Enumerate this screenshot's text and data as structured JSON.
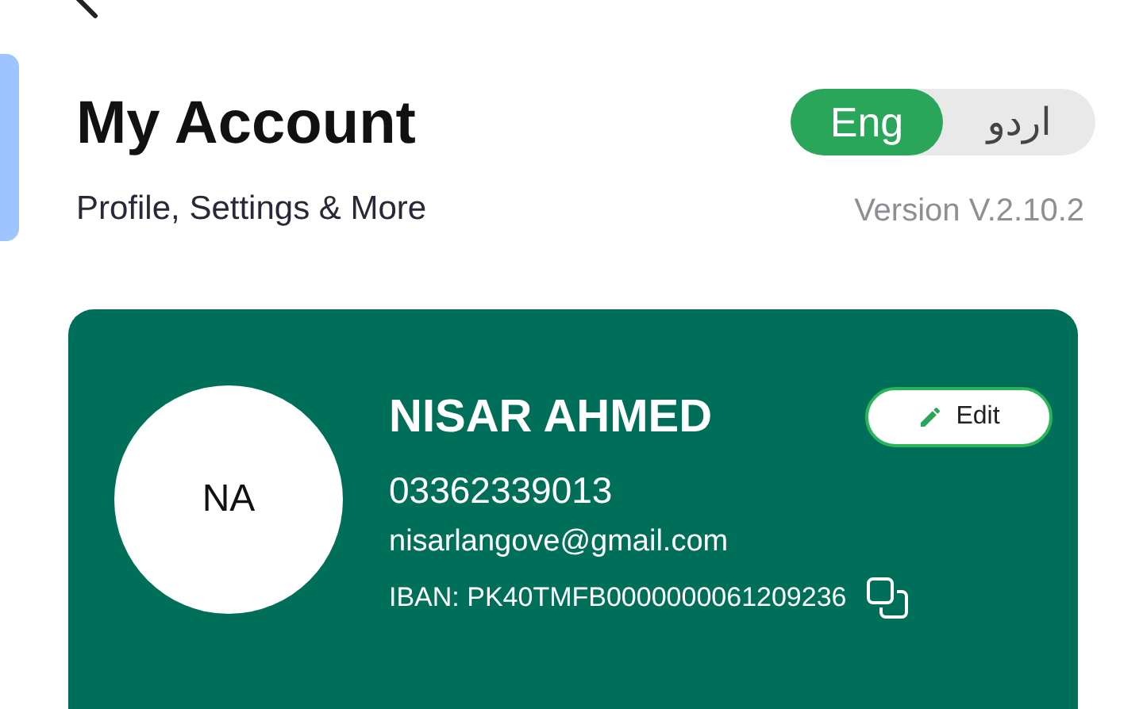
{
  "header": {
    "title": "My Account",
    "subtitle": "Profile, Settings & More",
    "version": "Version V.2.10.2"
  },
  "languages": [
    {
      "label": "Eng",
      "selected": true
    },
    {
      "label": "اردو",
      "selected": false
    }
  ],
  "profile": {
    "initials": "NA",
    "name": "NISAR AHMED",
    "edit_label": "Edit",
    "phone": "03362339013",
    "email": "nisarlangove@gmail.com",
    "iban": "IBAN: PK40TMFB0000000061209236"
  }
}
